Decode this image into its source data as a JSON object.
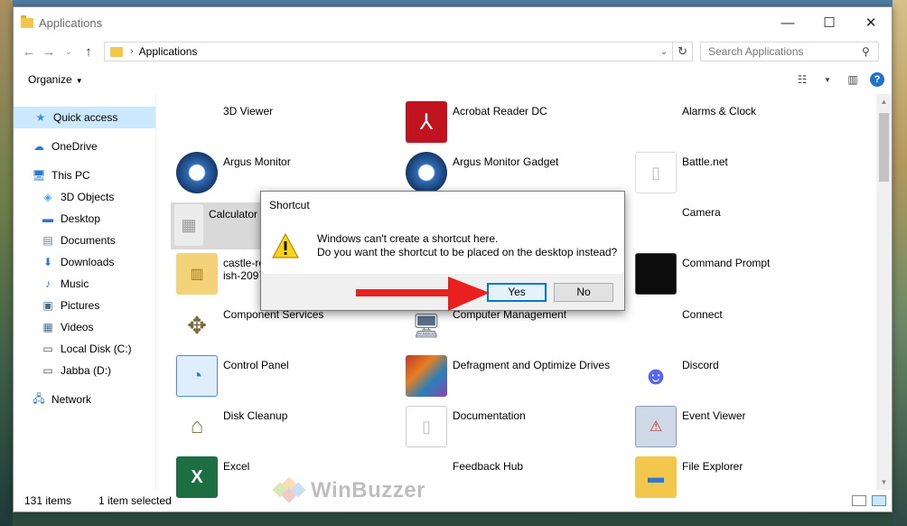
{
  "window": {
    "title": "Applications",
    "controls": {
      "minimize": "—",
      "maximize": "☐",
      "close": "✕"
    }
  },
  "address": {
    "path": "Applications",
    "search_placeholder": "Search Applications"
  },
  "toolbar": {
    "organize_label": "Organize"
  },
  "nav": {
    "quick_access": "Quick access",
    "onedrive": "OneDrive",
    "this_pc": "This PC",
    "objects_3d": "3D Objects",
    "desktop": "Desktop",
    "documents": "Documents",
    "downloads": "Downloads",
    "music": "Music",
    "pictures": "Pictures",
    "videos": "Videos",
    "local_disk": "Local Disk (C:)",
    "jabba": "Jabba (D:)",
    "network": "Network"
  },
  "apps": {
    "a1": "3D Viewer",
    "a2": "Acrobat Reader DC",
    "a3": "Alarms & Clock",
    "a4": "Argus Monitor",
    "a5": "Argus Monitor Gadget",
    "a6": "Battle.net",
    "a7": "Calculator",
    "a8": "Camera",
    "a9_line1": "castle-ro",
    "a9_line2": "ish-2097",
    "a10": "Command Prompt",
    "a11": "Component Services",
    "a12": "Computer Management",
    "a13": "Connect",
    "a14": "Control Panel",
    "a15": "Defragment and Optimize Drives",
    "a16": "Discord",
    "a17": "Disk Cleanup",
    "a18": "Documentation",
    "a19": "Event Viewer",
    "a20": "Excel",
    "a21": "Feedback Hub",
    "a22": "File Explorer"
  },
  "status": {
    "item_count": "131 items",
    "selected": "1 item selected"
  },
  "dialog": {
    "title": "Shortcut",
    "line1": "Windows can't create a shortcut here.",
    "line2": "Do you want the shortcut to be placed on the desktop instead?",
    "yes": "Yes",
    "no": "No"
  },
  "watermark": {
    "text": "WinBuzzer"
  },
  "colors": {
    "accent": "#0078d7",
    "selection": "#cce8ff",
    "arrow": "#e8201f"
  }
}
